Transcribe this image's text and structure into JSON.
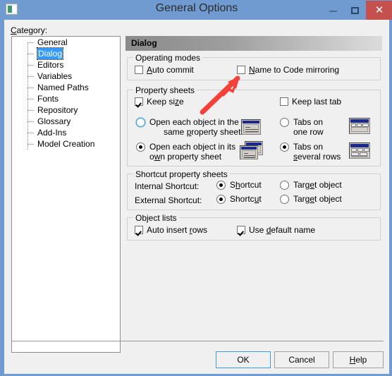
{
  "window": {
    "title": "General Options",
    "icon": "app-window-icon",
    "controls": {
      "minimize": "minimize-icon",
      "maximize": "maximize-icon",
      "close": "close-icon"
    }
  },
  "colors": {
    "titlebar": "#6f9bd1",
    "close_button": "#c5514f",
    "client_background": "#f0f0f0",
    "selection": "#3399ff",
    "focus_ring": "#3e9bdd",
    "annotation_arrow": "#f4413c",
    "group_border": "#d0d0d0",
    "mini_titlebar": "#1c2b8a"
  },
  "category": {
    "label": "Category:",
    "label_mnemonic": "C",
    "items": [
      {
        "label": "General",
        "selected": false
      },
      {
        "label": "Dialog",
        "selected": true
      },
      {
        "label": "Editors",
        "selected": false
      },
      {
        "label": "Variables",
        "selected": false
      },
      {
        "label": "Named Paths",
        "selected": false
      },
      {
        "label": "Fonts",
        "selected": false
      },
      {
        "label": "Repository",
        "selected": false
      },
      {
        "label": "Glossary",
        "selected": false
      },
      {
        "label": "Add-Ins",
        "selected": false
      },
      {
        "label": "Model Creation",
        "selected": false
      }
    ]
  },
  "panel": {
    "header": "Dialog",
    "operating_modes": {
      "legend": "Operating modes",
      "auto_commit": {
        "label": "Auto commit",
        "mnemonic": "A",
        "checked": false
      },
      "name_to_code": {
        "label": "Name to Code mirroring",
        "mnemonic": "N",
        "checked": false
      }
    },
    "property_sheets": {
      "legend": "Property sheets",
      "keep_size": {
        "label": "Keep size",
        "mnemonic": "z",
        "checked": true
      },
      "keep_last_tab": {
        "label": "Keep last tab",
        "checked": false
      },
      "open_same": {
        "line1": "Open each object in the",
        "line2": "same property sheet:",
        "mnemonic": "p",
        "selected": false,
        "focused": true,
        "preview": "single-property-sheet-preview-icon"
      },
      "open_own": {
        "line1": "Open each object in its",
        "line2": "own property sheet",
        "mnemonic": "w",
        "selected": true,
        "focused": false,
        "preview": "multiple-property-sheets-preview-icon"
      },
      "tabs_one_row": {
        "line1": "Tabs on",
        "line2": "one row",
        "selected": false,
        "preview": "tabs-one-row-preview-icon"
      },
      "tabs_several_rows": {
        "line1": "Tabs on",
        "line2": "several rows",
        "mnemonic": "s",
        "selected": true,
        "preview": "tabs-several-rows-preview-icon"
      }
    },
    "shortcut_property_sheets": {
      "legend": "Shortcut property sheets",
      "internal": {
        "label": "Internal Shortcut:",
        "option_shortcut": {
          "label": "Shortcut",
          "mnemonic": "h",
          "selected": true
        },
        "option_target": {
          "label": "Target object",
          "mnemonic": "e",
          "selected": false
        }
      },
      "external": {
        "label": "External Shortcut:",
        "option_shortcut": {
          "label": "Shortcut",
          "mnemonic": "u",
          "selected": true
        },
        "option_target": {
          "label": "Target object",
          "mnemonic": "e",
          "selected": false
        }
      }
    },
    "object_lists": {
      "legend": "Object lists",
      "auto_insert_rows": {
        "label": "Auto insert rows",
        "mnemonic": "r",
        "checked": true
      },
      "use_default_name": {
        "label": "Use default name",
        "mnemonic": "d",
        "checked": true
      }
    }
  },
  "buttons": {
    "ok": "OK",
    "cancel": "Cancel",
    "help": "Help",
    "help_mnemonic": "H"
  },
  "annotation": {
    "type": "arrow",
    "points_at": "name-to-code-mirroring-checkbox",
    "color": "#f4413c"
  }
}
